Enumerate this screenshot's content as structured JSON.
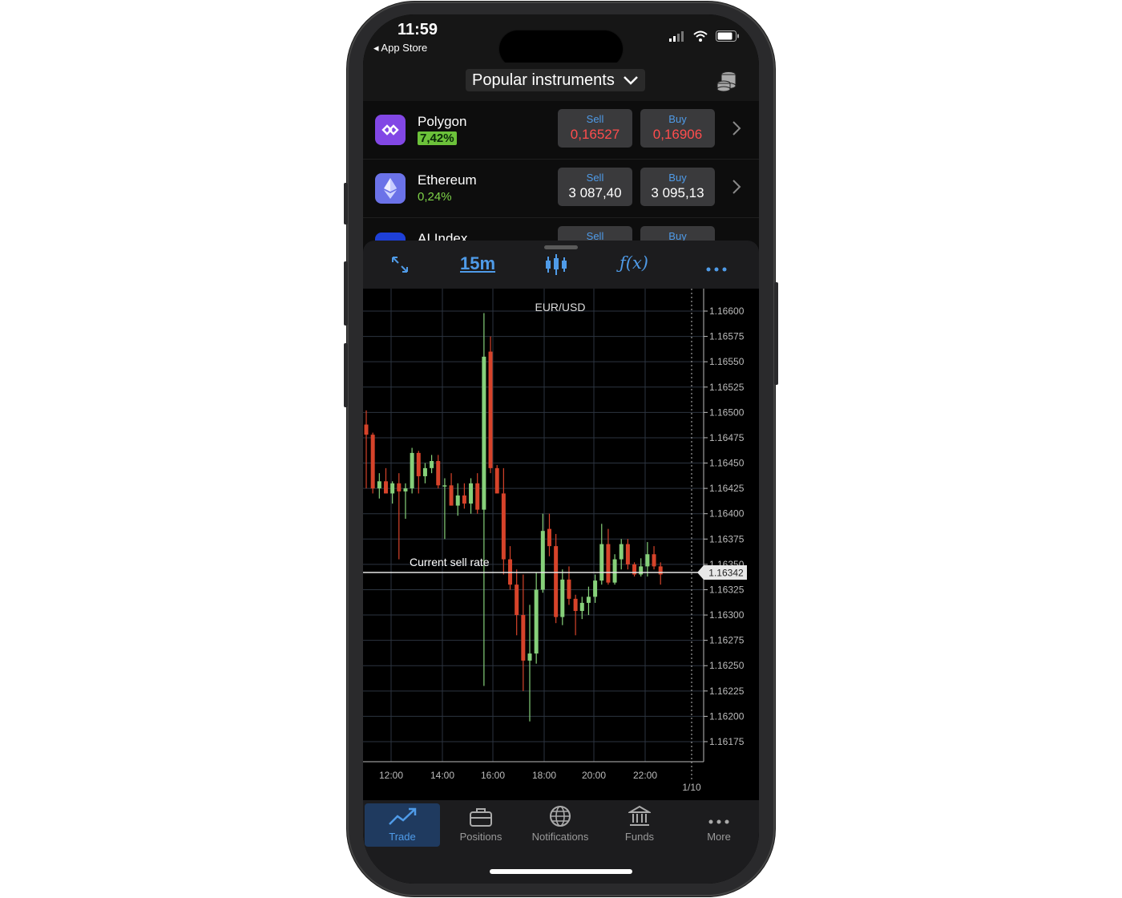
{
  "status_bar": {
    "time": "11:59",
    "back_label": "◂ App Store"
  },
  "header": {
    "title": "Popular instruments",
    "coins_icon": "coins-stack-icon"
  },
  "instruments": [
    {
      "name": "Polygon",
      "change": "7,42%",
      "sell_label": "Sell",
      "sell": "0,16527",
      "buy_label": "Buy",
      "buy": "0,16906",
      "price_color": "#ff4d4d",
      "logo_color": "#8247e5"
    },
    {
      "name": "Ethereum",
      "change": "0,24%",
      "sell_label": "Sell",
      "sell": "3 087,40",
      "buy_label": "Buy",
      "buy": "3 095,13",
      "price_color": "#ffffff",
      "logo_color": "#6b72e8"
    },
    {
      "name": "AI Index",
      "sell_label": "Sell",
      "buy_label": "Buy"
    }
  ],
  "toolbar": {
    "timeframe": "15m",
    "fx": "ƒ(x)"
  },
  "chart_data": {
    "type": "candlestick",
    "title": "EUR/USD",
    "annotation": "Current sell rate",
    "current_price": "1.16342",
    "x_ticks": [
      "12:00",
      "14:00",
      "16:00",
      "18:00",
      "20:00",
      "22:00"
    ],
    "x_date_label": "1/10",
    "y_ticks": [
      "1.16600",
      "1.16575",
      "1.16550",
      "1.16525",
      "1.16500",
      "1.16475",
      "1.16450",
      "1.16425",
      "1.16400",
      "1.16375",
      "1.16350",
      "1.16325",
      "1.16300",
      "1.16275",
      "1.16250",
      "1.16225",
      "1.16200",
      "1.16175"
    ],
    "ylim": [
      1.1615,
      1.1662
    ],
    "candles": [
      {
        "o": 1.16488,
        "h": 1.16502,
        "l": 1.16425,
        "c": 1.16478
      },
      {
        "o": 1.16478,
        "h": 1.1648,
        "l": 1.1642,
        "c": 1.16425
      },
      {
        "o": 1.16425,
        "h": 1.1644,
        "l": 1.16415,
        "c": 1.16432
      },
      {
        "o": 1.16432,
        "h": 1.16445,
        "l": 1.1642,
        "c": 1.1642
      },
      {
        "o": 1.1642,
        "h": 1.16432,
        "l": 1.1641,
        "c": 1.1643
      },
      {
        "o": 1.1643,
        "h": 1.1644,
        "l": 1.16355,
        "c": 1.16422
      },
      {
        "o": 1.16422,
        "h": 1.1643,
        "l": 1.16395,
        "c": 1.16425
      },
      {
        "o": 1.16425,
        "h": 1.16465,
        "l": 1.1642,
        "c": 1.1646
      },
      {
        "o": 1.1646,
        "h": 1.16462,
        "l": 1.1642,
        "c": 1.16437
      },
      {
        "o": 1.16437,
        "h": 1.1645,
        "l": 1.1643,
        "c": 1.16445
      },
      {
        "o": 1.16445,
        "h": 1.16458,
        "l": 1.1644,
        "c": 1.16452
      },
      {
        "o": 1.16452,
        "h": 1.16458,
        "l": 1.16425,
        "c": 1.16428
      },
      {
        "o": 1.16428,
        "h": 1.16435,
        "l": 1.16375,
        "c": 1.16428
      },
      {
        "o": 1.16428,
        "h": 1.1644,
        "l": 1.16408,
        "c": 1.16408
      },
      {
        "o": 1.16408,
        "h": 1.1643,
        "l": 1.16398,
        "c": 1.16418
      },
      {
        "o": 1.16418,
        "h": 1.1643,
        "l": 1.16405,
        "c": 1.1641
      },
      {
        "o": 1.1641,
        "h": 1.16435,
        "l": 1.164,
        "c": 1.1643
      },
      {
        "o": 1.1643,
        "h": 1.1644,
        "l": 1.164,
        "c": 1.16404
      },
      {
        "o": 1.16404,
        "h": 1.16598,
        "l": 1.1623,
        "c": 1.16555
      },
      {
        "o": 1.1656,
        "h": 1.16575,
        "l": 1.1644,
        "c": 1.16445
      },
      {
        "o": 1.16445,
        "h": 1.16448,
        "l": 1.1642,
        "c": 1.1642
      },
      {
        "o": 1.1642,
        "h": 1.16445,
        "l": 1.1634,
        "c": 1.16355
      },
      {
        "o": 1.16355,
        "h": 1.16368,
        "l": 1.16325,
        "c": 1.1633
      },
      {
        "o": 1.1633,
        "h": 1.16345,
        "l": 1.1628,
        "c": 1.163
      },
      {
        "o": 1.163,
        "h": 1.1634,
        "l": 1.16225,
        "c": 1.16255
      },
      {
        "o": 1.16255,
        "h": 1.1631,
        "l": 1.16195,
        "c": 1.16262
      },
      {
        "o": 1.16262,
        "h": 1.16342,
        "l": 1.16252,
        "c": 1.16325
      },
      {
        "o": 1.16325,
        "h": 1.164,
        "l": 1.16322,
        "c": 1.16383
      },
      {
        "o": 1.16385,
        "h": 1.164,
        "l": 1.16358,
        "c": 1.16368
      },
      {
        "o": 1.16368,
        "h": 1.1638,
        "l": 1.16292,
        "c": 1.16298
      },
      {
        "o": 1.16298,
        "h": 1.16345,
        "l": 1.1629,
        "c": 1.16335
      },
      {
        "o": 1.16335,
        "h": 1.16348,
        "l": 1.1631,
        "c": 1.16316
      },
      {
        "o": 1.16316,
        "h": 1.1632,
        "l": 1.1628,
        "c": 1.16304
      },
      {
        "o": 1.16304,
        "h": 1.16318,
        "l": 1.16296,
        "c": 1.16312
      },
      {
        "o": 1.16312,
        "h": 1.16328,
        "l": 1.163,
        "c": 1.16318
      },
      {
        "o": 1.16318,
        "h": 1.1634,
        "l": 1.16312,
        "c": 1.16334
      },
      {
        "o": 1.16334,
        "h": 1.1639,
        "l": 1.1633,
        "c": 1.1637
      },
      {
        "o": 1.1637,
        "h": 1.16385,
        "l": 1.1633,
        "c": 1.16332
      },
      {
        "o": 1.16332,
        "h": 1.1636,
        "l": 1.1633,
        "c": 1.16355
      },
      {
        "o": 1.16355,
        "h": 1.16375,
        "l": 1.16345,
        "c": 1.1637
      },
      {
        "o": 1.1637,
        "h": 1.16375,
        "l": 1.16345,
        "c": 1.1635
      },
      {
        "o": 1.1635,
        "h": 1.16352,
        "l": 1.16338,
        "c": 1.1634
      },
      {
        "o": 1.1634,
        "h": 1.16356,
        "l": 1.16338,
        "c": 1.16348
      },
      {
        "o": 1.16348,
        "h": 1.16372,
        "l": 1.16338,
        "c": 1.1636
      },
      {
        "o": 1.1636,
        "h": 1.16368,
        "l": 1.16345,
        "c": 1.16348
      },
      {
        "o": 1.16348,
        "h": 1.16352,
        "l": 1.1633,
        "c": 1.1634
      }
    ],
    "up_color": "#86d07a",
    "down_color": "#d6432a"
  },
  "tabs": [
    {
      "label": "Trade",
      "icon": "trending-up-icon",
      "active": true
    },
    {
      "label": "Positions",
      "icon": "briefcase-icon"
    },
    {
      "label": "Notifications",
      "icon": "globe-icon"
    },
    {
      "label": "Funds",
      "icon": "bank-icon"
    },
    {
      "label": "More",
      "icon": "more-dots-icon"
    }
  ],
  "colors": {
    "accent": "#4f9be8",
    "up": "#7ed348",
    "down": "#ff4d4d"
  }
}
